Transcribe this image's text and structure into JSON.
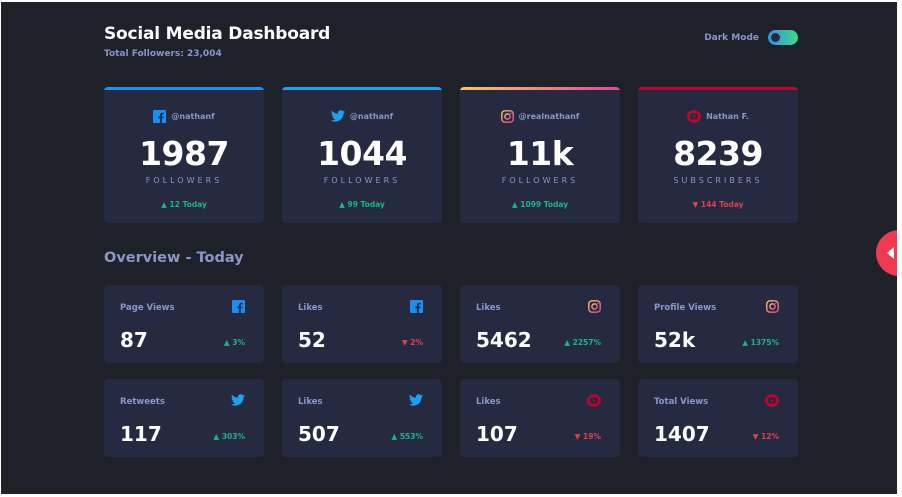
{
  "header": {
    "title": "Social Media Dashboard",
    "total_followers": "Total Followers: 23,004",
    "dark_mode_label": "Dark Mode",
    "dark_mode_on": true
  },
  "colors": {
    "background": "#1e202a",
    "card": "#252a41",
    "text_muted": "#8b97c6",
    "up": "#1db489",
    "down": "#dc414c",
    "facebook": "#198ff5",
    "twitter": "#1ca0f2",
    "youtube": "#c4032a",
    "instagram_gradient": [
      "#fdc468",
      "#df4996"
    ],
    "side_tab": "#ee3950"
  },
  "followers": [
    {
      "platform": "facebook",
      "icon": "facebook-icon",
      "handle": "@nathanf",
      "count": "1987",
      "unit": "FOLLOWERS",
      "change": "12 Today",
      "trend": "up"
    },
    {
      "platform": "twitter",
      "icon": "twitter-icon",
      "handle": "@nathanf",
      "count": "1044",
      "unit": "FOLLOWERS",
      "change": "99 Today",
      "trend": "up"
    },
    {
      "platform": "instagram",
      "icon": "instagram-icon",
      "handle": "@realnathanf",
      "count": "11k",
      "unit": "FOLLOWERS",
      "change": "1099 Today",
      "trend": "up"
    },
    {
      "platform": "youtube",
      "icon": "youtube-icon",
      "handle": "Nathan F.",
      "count": "8239",
      "unit": "SUBSCRIBERS",
      "change": "144 Today",
      "trend": "down"
    }
  ],
  "overview": {
    "title": "Overview - Today",
    "items": [
      {
        "label": "Page Views",
        "icon": "facebook-icon",
        "value": "87",
        "change": "3%",
        "trend": "up"
      },
      {
        "label": "Likes",
        "icon": "facebook-icon",
        "value": "52",
        "change": "2%",
        "trend": "down"
      },
      {
        "label": "Likes",
        "icon": "instagram-icon",
        "value": "5462",
        "change": "2257%",
        "trend": "up"
      },
      {
        "label": "Profile Views",
        "icon": "instagram-icon",
        "value": "52k",
        "change": "1375%",
        "trend": "up"
      },
      {
        "label": "Retweets",
        "icon": "twitter-icon",
        "value": "117",
        "change": "303%",
        "trend": "up"
      },
      {
        "label": "Likes",
        "icon": "twitter-icon",
        "value": "507",
        "change": "553%",
        "trend": "up"
      },
      {
        "label": "Likes",
        "icon": "youtube-icon",
        "value": "107",
        "change": "19%",
        "trend": "down"
      },
      {
        "label": "Total Views",
        "icon": "youtube-icon",
        "value": "1407",
        "change": "12%",
        "trend": "down"
      }
    ]
  },
  "side_tab": {
    "icon": "chevron-left-icon"
  }
}
